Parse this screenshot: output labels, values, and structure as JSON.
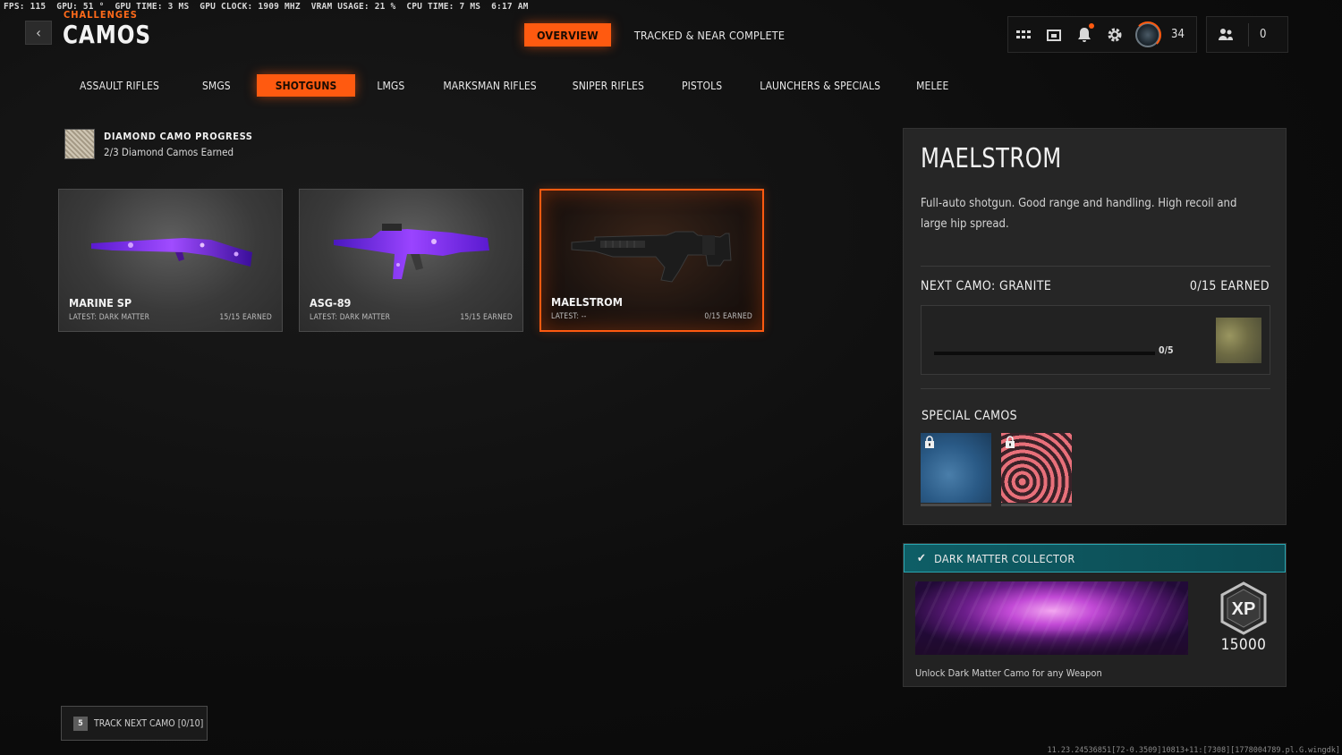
{
  "perf": {
    "fps": "FPS: 115",
    "gpu": "GPU: 51 °",
    "gpu_time": "GPU TIME: 3 MS",
    "gpu_clock": "GPU CLOCK: 1909 MHZ",
    "vram": "VRAM USAGE: 21 %",
    "cpu_time": "CPU TIME: 7 MS",
    "clock": "6:17 AM"
  },
  "header": {
    "breadcrumb": "CHALLENGES",
    "title": "CAMOS",
    "tabs": [
      {
        "label": "OVERVIEW",
        "active": true
      },
      {
        "label": "TRACKED & NEAR COMPLETE",
        "active": false
      }
    ],
    "player_level": "34",
    "friends_count": "0"
  },
  "categories": [
    {
      "label": "ASSAULT RIFLES",
      "active": false
    },
    {
      "label": "SMGS",
      "active": false
    },
    {
      "label": "SHOTGUNS",
      "active": true
    },
    {
      "label": "LMGS",
      "active": false
    },
    {
      "label": "MARKSMAN RIFLES",
      "active": false
    },
    {
      "label": "SNIPER RIFLES",
      "active": false
    },
    {
      "label": "PISTOLS",
      "active": false
    },
    {
      "label": "LAUNCHERS & SPECIALS",
      "active": false
    },
    {
      "label": "MELEE",
      "active": false
    }
  ],
  "diamond": {
    "title": "DIAMOND CAMO PROGRESS",
    "subtitle": "2/3 Diamond Camos Earned"
  },
  "weapons": [
    {
      "name": "MARINE SP",
      "latest": "LATEST: DARK MATTER",
      "earned": "15/15 EARNED",
      "selected": false
    },
    {
      "name": "ASG-89",
      "latest": "LATEST: DARK MATTER",
      "earned": "15/15 EARNED",
      "selected": false
    },
    {
      "name": "MAELSTROM",
      "latest": "LATEST: --",
      "earned": "0/15 EARNED",
      "selected": true
    }
  ],
  "detail": {
    "title": "MAELSTROM",
    "description": "Full-auto shotgun. Good range and handling. High recoil and large hip spread.",
    "next_camo_label": "NEXT CAMO: GRANITE",
    "next_camo_earned": "0/15 EARNED",
    "progress_text": "0/5",
    "progress_fraction": 0,
    "special_label": "SPECIAL CAMOS"
  },
  "challenge": {
    "title": "DARK MATTER COLLECTOR",
    "xp": "15000",
    "description": "Unlock Dark Matter Camo for any Weapon"
  },
  "track": {
    "key": "5",
    "label": "TRACK NEXT CAMO [0/10]"
  },
  "build": "11.23.24536851[72-0.3509]10813+11:[7308][1778004789.pl.G.wingdk]",
  "colors": {
    "accent": "#ff5a10",
    "challenge_teal": "#0e5e66",
    "panel_bg": "#262626"
  }
}
